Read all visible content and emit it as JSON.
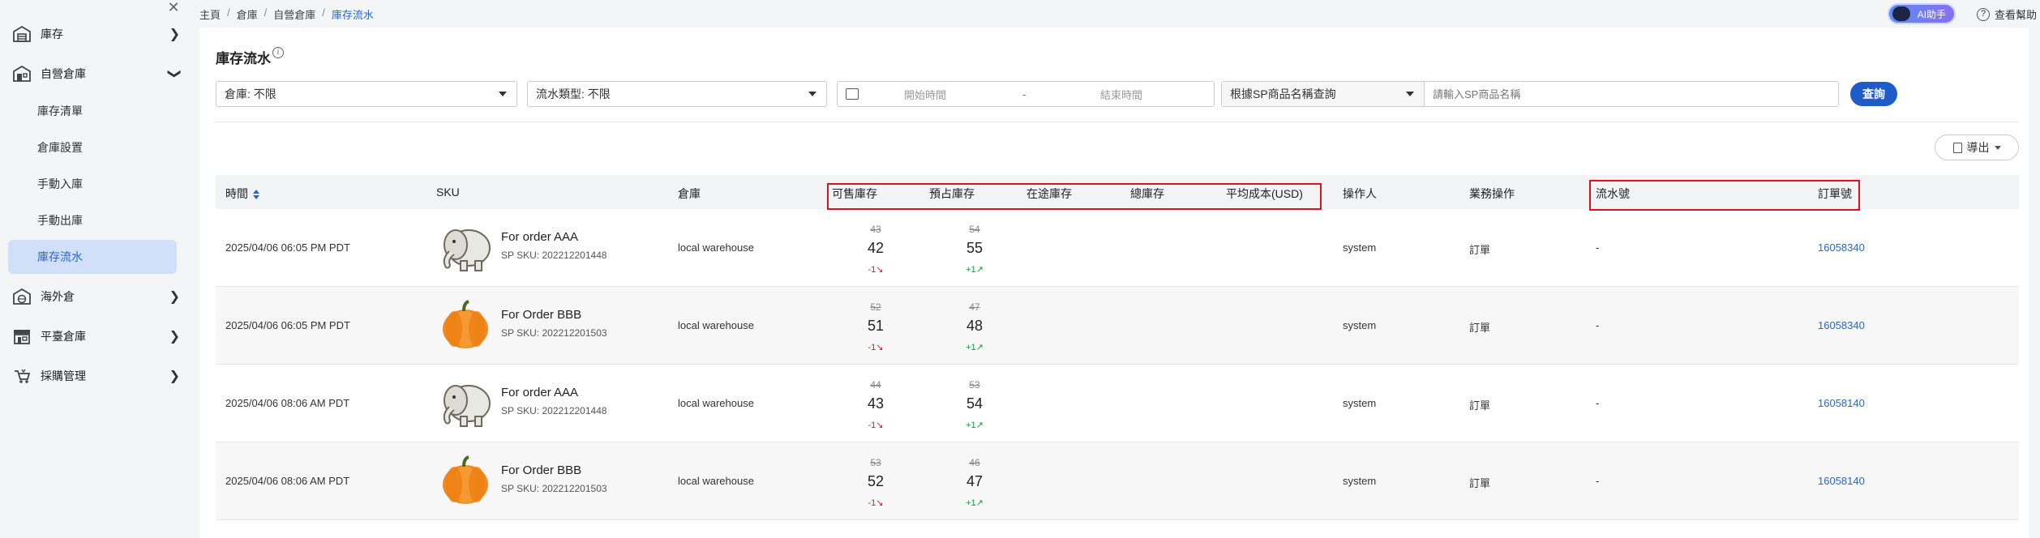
{
  "sidebar": {
    "items": [
      {
        "label": "庫存",
        "icon": "warehouse-icon"
      },
      {
        "label": "自營倉庫",
        "icon": "self-warehouse-icon"
      },
      {
        "label": "海外倉",
        "icon": "overseas-warehouse-icon"
      },
      {
        "label": "平臺倉庫",
        "icon": "platform-warehouse-icon"
      },
      {
        "label": "採購管理",
        "icon": "purchase-icon"
      }
    ],
    "sub_items": [
      {
        "label": "庫存清單"
      },
      {
        "label": "倉庫設置"
      },
      {
        "label": "手動入庫"
      },
      {
        "label": "手動出庫"
      },
      {
        "label": "庫存流水",
        "active": true
      }
    ]
  },
  "breadcrumb": [
    "主頁",
    "倉庫",
    "自營倉庫",
    "庫存流水"
  ],
  "header": {
    "ai_label": "AI助手",
    "help_label": "查看幫助"
  },
  "page": {
    "title": "庫存流水"
  },
  "filters": {
    "warehouse": "倉庫: 不限",
    "flow_type": "流水類型: 不限",
    "start_placeholder": "開始時間",
    "date_sep": "-",
    "end_placeholder": "結束時間",
    "search_mode": "根據SP商品名稱查詢",
    "search_placeholder": "請輸入SP商品名稱",
    "query_label": "查詢"
  },
  "toolbar": {
    "export_label": "導出"
  },
  "table": {
    "columns": {
      "time": "時間",
      "sku": "SKU",
      "warehouse": "倉庫",
      "available": "可售庫存",
      "reserved": "預占庫存",
      "in_transit": "在途庫存",
      "total": "總庫存",
      "avg_cost": "平均成本(USD)",
      "operator": "操作人",
      "business": "業務操作",
      "flow_no": "流水號",
      "order_no": "訂單號"
    },
    "rows": [
      {
        "time": "2025/04/06 06:05 PM PDT",
        "name": "For order AAA",
        "sku": "SP SKU: 202212201448",
        "image": "elephant-icon",
        "warehouse": "local warehouse",
        "avail_old": "43",
        "avail_new": "42",
        "avail_chg": "-1",
        "res_old": "54",
        "res_new": "55",
        "res_chg": "+1",
        "operator": "system",
        "business": "訂單",
        "flow_no": "-",
        "order_no": "16058340"
      },
      {
        "time": "2025/04/06 06:05 PM PDT",
        "name": "For Order BBB",
        "sku": "SP SKU: 202212201503",
        "image": "pumpkin-icon",
        "warehouse": "local warehouse",
        "avail_old": "52",
        "avail_new": "51",
        "avail_chg": "-1",
        "res_old": "47",
        "res_new": "48",
        "res_chg": "+1",
        "operator": "system",
        "business": "訂單",
        "flow_no": "-",
        "order_no": "16058340"
      },
      {
        "time": "2025/04/06 08:06 AM PDT",
        "name": "For order AAA",
        "sku": "SP SKU: 202212201448",
        "image": "elephant-icon",
        "warehouse": "local warehouse",
        "avail_old": "44",
        "avail_new": "43",
        "avail_chg": "-1",
        "res_old": "53",
        "res_new": "54",
        "res_chg": "+1",
        "operator": "system",
        "business": "訂單",
        "flow_no": "-",
        "order_no": "16058140"
      },
      {
        "time": "2025/04/06 08:06 AM PDT",
        "name": "For Order BBB",
        "sku": "SP SKU: 202212201503",
        "image": "pumpkin-icon",
        "warehouse": "local warehouse",
        "avail_old": "53",
        "avail_new": "52",
        "avail_chg": "-1",
        "res_old": "46",
        "res_new": "47",
        "res_chg": "+1",
        "operator": "system",
        "business": "訂單",
        "flow_no": "-",
        "order_no": "16058140"
      }
    ]
  },
  "colors": {
    "accent": "#1f5cc8",
    "highlight_box": "#e0111b",
    "down": "#e0111b",
    "up": "#1a9b3b",
    "active_bg": "#cfe0f8"
  }
}
